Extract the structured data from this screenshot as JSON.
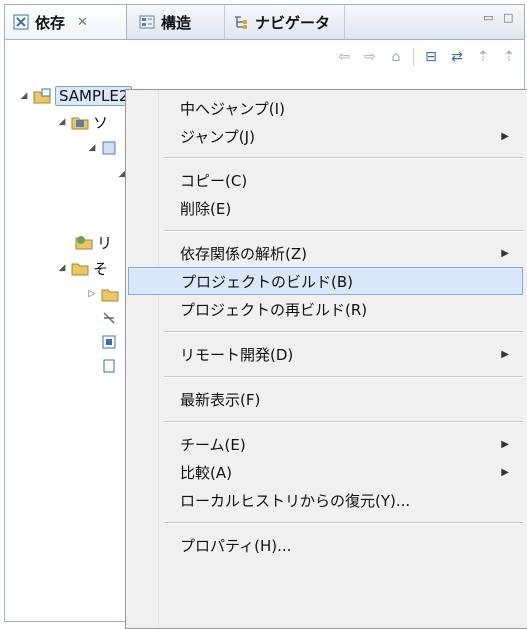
{
  "tabs": [
    {
      "label": "依存",
      "icon": "dependency-icon",
      "active": true
    },
    {
      "label": "構造",
      "icon": "structure-icon",
      "active": false
    },
    {
      "label": "ナビゲータ",
      "icon": "navigator-icon",
      "active": false
    }
  ],
  "tree": {
    "root_label": "SAMPLE2",
    "child_fragments": [
      "ソ",
      "リ",
      "そ"
    ]
  },
  "menu": {
    "items": [
      {
        "label": "中へジャンプ(I)",
        "submenu": false,
        "highlighted": false
      },
      {
        "label": "ジャンプ(J)",
        "submenu": true,
        "highlighted": false
      },
      {
        "label": "コピー(C)",
        "submenu": false,
        "highlighted": false
      },
      {
        "label": "削除(E)",
        "submenu": false,
        "highlighted": false
      },
      {
        "label": "依存関係の解析(Z)",
        "submenu": true,
        "highlighted": false
      },
      {
        "label": "プロジェクトのビルド(B)",
        "submenu": false,
        "highlighted": true
      },
      {
        "label": "プロジェクトの再ビルド(R)",
        "submenu": false,
        "highlighted": false
      },
      {
        "label": "リモート開発(D)",
        "submenu": true,
        "highlighted": false
      },
      {
        "label": "最新表示(F)",
        "submenu": false,
        "highlighted": false
      },
      {
        "label": "チーム(E)",
        "submenu": true,
        "highlighted": false
      },
      {
        "label": "比較(A)",
        "submenu": true,
        "highlighted": false
      },
      {
        "label": "ローカルヒストリからの復元(Y)...",
        "submenu": false,
        "highlighted": false
      },
      {
        "label": "プロパティ(H)...",
        "submenu": false,
        "highlighted": false
      }
    ]
  },
  "colors": {
    "accent": "#2f6db5",
    "highlight_bg": "#d9e7f8",
    "highlight_border": "#84acdd"
  }
}
